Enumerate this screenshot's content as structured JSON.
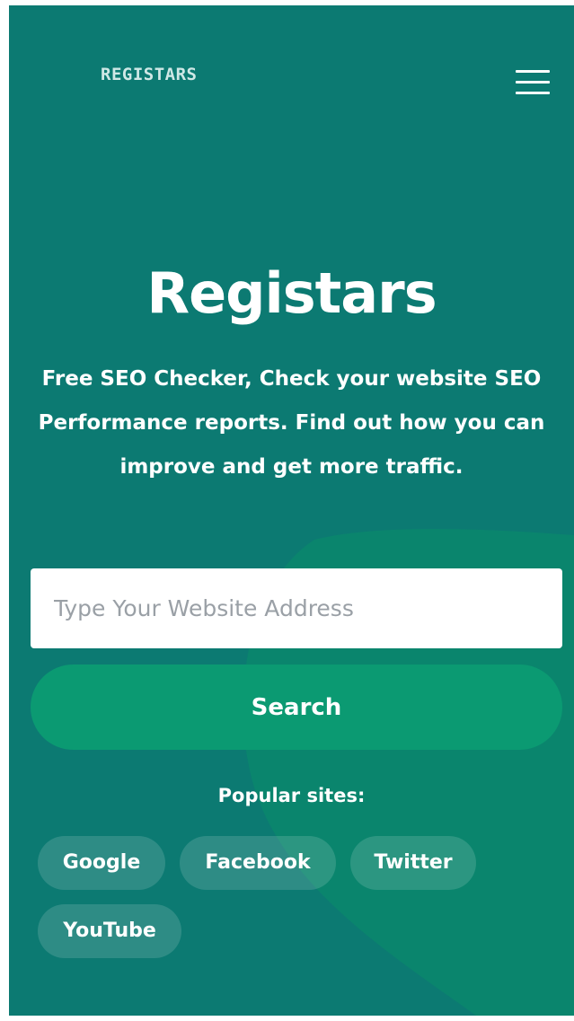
{
  "header": {
    "logo_text": "REGISTARS",
    "menu_icon": "hamburger-menu-icon"
  },
  "hero": {
    "title": "Registars",
    "subtitle": "Free SEO Checker, Check your website SEO Performance reports. Find out how you can improve and get more traffic."
  },
  "search": {
    "placeholder": "Type Your Website Address",
    "value": "",
    "button_label": "Search"
  },
  "popular": {
    "label": "Popular sites:",
    "sites": [
      "Google",
      "Facebook",
      "Twitter",
      "YouTube"
    ]
  },
  "colors": {
    "background": "#0c7a72",
    "accent_blob": "#0a8a6c",
    "button": "#0b9a72",
    "text": "#ffffff"
  }
}
